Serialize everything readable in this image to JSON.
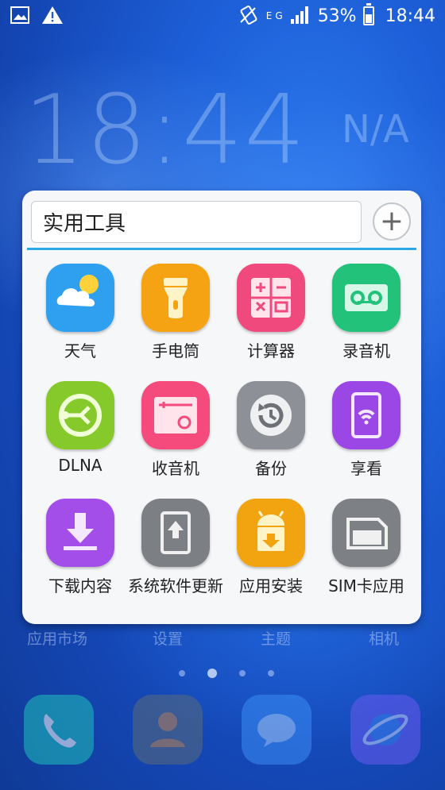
{
  "status_bar": {
    "battery": "53%",
    "time": "18:44",
    "network": "E",
    "network2": "G",
    "battery_level": 0.53
  },
  "lockscreen": {
    "clock": "18:44",
    "weather": "N/A"
  },
  "folder": {
    "title": "实用工具",
    "add_label": "+",
    "apps": [
      {
        "label": "天气",
        "icon": "weather-icon",
        "color": "#2fa0f0"
      },
      {
        "label": "手电筒",
        "icon": "flashlight-icon",
        "color": "#f5a313"
      },
      {
        "label": "计算器",
        "icon": "calculator-icon",
        "color": "#f0497e"
      },
      {
        "label": "录音机",
        "icon": "recorder-icon",
        "color": "#22c27a"
      },
      {
        "label": "DLNA",
        "icon": "dlna-icon",
        "color": "#86c92a"
      },
      {
        "label": "收音机",
        "icon": "radio-icon",
        "color": "#f44a7c"
      },
      {
        "label": "备份",
        "icon": "backup-icon",
        "color": "#8d9197"
      },
      {
        "label": "享看",
        "icon": "video-icon",
        "color": "#9b47e6"
      },
      {
        "label": "下载内容",
        "icon": "download-icon",
        "color": "#a34ee8"
      },
      {
        "label": "系统软件更新",
        "icon": "update-icon",
        "color": "#7c7f84"
      },
      {
        "label": "应用安装",
        "icon": "installer-icon",
        "color": "#f2a310"
      },
      {
        "label": "SIM卡应用",
        "icon": "sim-icon",
        "color": "#7d8085"
      }
    ]
  },
  "home_labels": [
    "应用市场",
    "设置",
    "主题",
    "相机"
  ],
  "pages": {
    "count": 4,
    "active": 2
  },
  "dock": [
    {
      "icon": "phone-icon",
      "color": "#1fc1b8"
    },
    {
      "icon": "contacts-icon",
      "color": "#c98a4a"
    },
    {
      "icon": "messages-icon",
      "color": "#5aa6ff"
    },
    {
      "icon": "browser-icon",
      "color": "#9c5bf0"
    }
  ]
}
